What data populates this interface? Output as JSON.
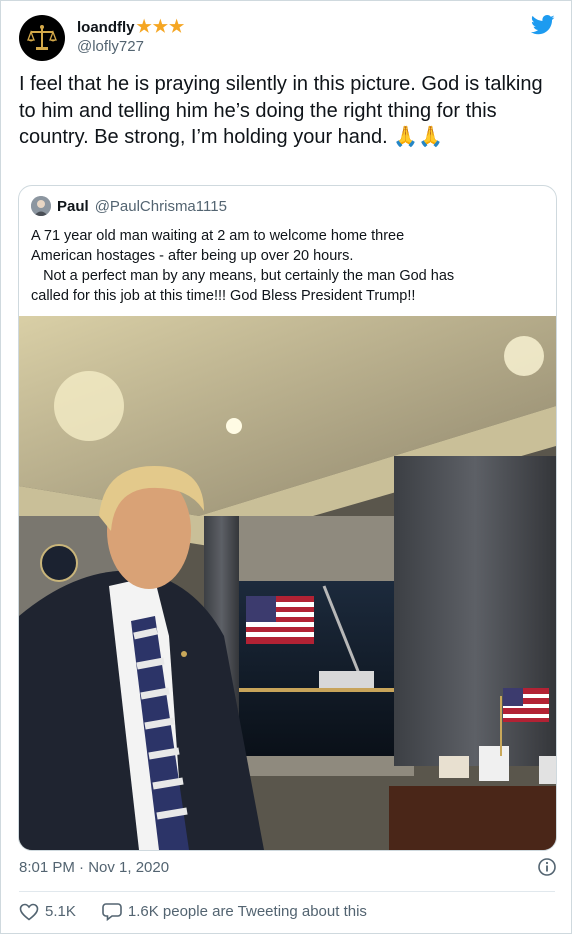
{
  "author": {
    "name": "loandfly",
    "stars": "★★★",
    "handle": "@lofly727"
  },
  "tweet": {
    "text": "I feel that he is praying silently in this picture. God is talking to him and telling him he’s doing the right thing for this country. Be strong, I’m holding your hand. 🙏🙏"
  },
  "quoted": {
    "name": "Paul",
    "handle": "@PaulChrisma1115",
    "lines": [
      "A 71 year old man waiting at 2 am to welcome home three",
      "American hostages - after being up over 20 hours.",
      "   Not a perfect man by any means, but certainly the man God has",
      "called for this job at this time!!! God Bless President Trump!!"
    ]
  },
  "timestamp": "8:01 PM · Nov 1, 2020",
  "actions": {
    "likes": "5.1K",
    "retweets_text": "1.6K people are Tweeting about this"
  },
  "icons": {
    "brand": "twitter-bird-icon",
    "like": "heart-icon",
    "reply": "speech-bubble-icon",
    "info": "info-icon"
  },
  "colors": {
    "twitter_blue": "#1d9bf0",
    "star": "#f5a623",
    "secondary_text": "#536471"
  }
}
